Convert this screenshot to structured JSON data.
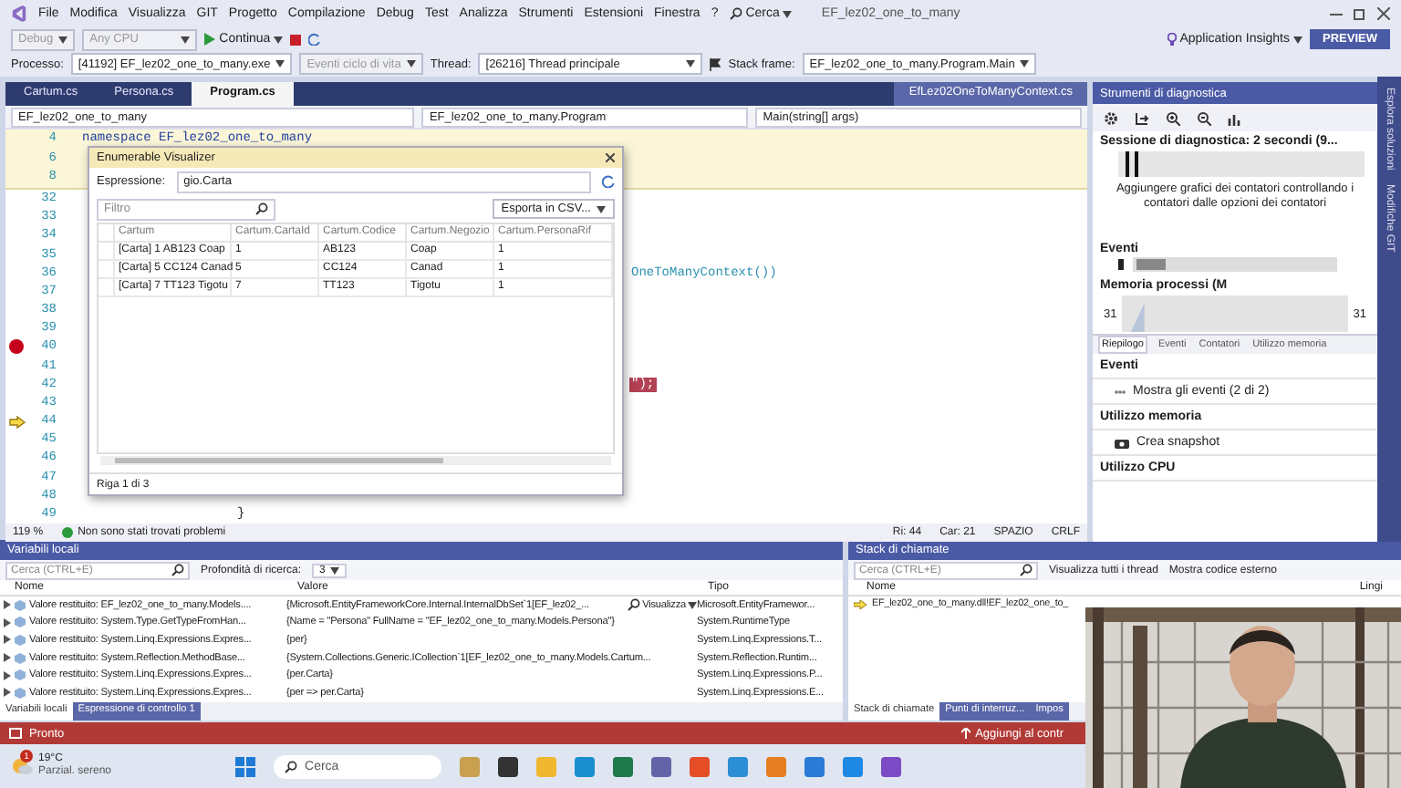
{
  "menu_bar": {
    "items": [
      "File",
      "Modifica",
      "Visualizza",
      "GIT",
      "Progetto",
      "Compilazione",
      "Debug",
      "Test",
      "Analizza",
      "Strumenti",
      "Estensioni",
      "Finestra",
      "?"
    ],
    "search": "Cerca",
    "title": "EF_lez02_one_to_many"
  },
  "toolbar": {
    "configuration": "Debug",
    "platform": "Any CPU",
    "continue": "Continua",
    "insights": "Application Insights",
    "preview": "PREVIEW"
  },
  "debug_location": {
    "process_label": "Processo:",
    "process": "[41192] EF_lez02_one_to_many.exe",
    "lifecycle": "Eventi ciclo di vita",
    "thread_label": "Thread:",
    "thread": "[26216] Thread principale",
    "frame_label": "Stack frame:",
    "frame": "EF_lez02_one_to_many.Program.Main"
  },
  "editor": {
    "tabs": [
      {
        "label": "Cartum.cs",
        "selected": false
      },
      {
        "label": "Persona.cs",
        "selected": false
      },
      {
        "label": "Program.cs",
        "selected": true
      }
    ],
    "preview_tab": "EfLez02OneToManyContext.cs",
    "nav": [
      "EF_lez02_one_to_many",
      "EF_lez02_one_to_many.Program",
      "Main(string[] args)"
    ],
    "sticky_lines": [
      {
        "number": "4",
        "code": "namespace EF_lez02_one_to_many"
      },
      {
        "number": "6"
      },
      {
        "number": "8"
      }
    ],
    "lines": [
      {
        "number": "32",
        "breakpoint": false,
        "current": false
      },
      {
        "number": "33",
        "breakpoint": false,
        "current": false
      },
      {
        "number": "34",
        "breakpoint": false,
        "current": false
      },
      {
        "number": "35",
        "breakpoint": false,
        "current": false
      },
      {
        "number": "36",
        "breakpoint": false,
        "current": false,
        "code": {
          "kind": "tail",
          "text": "OneToManyContext())",
          "highlighted": false
        }
      },
      {
        "number": "37",
        "breakpoint": false,
        "current": false
      },
      {
        "number": "38",
        "breakpoint": false,
        "current": false
      },
      {
        "number": "39",
        "breakpoint": false,
        "current": false
      },
      {
        "number": "40",
        "breakpoint": true,
        "current": false
      },
      {
        "number": "41",
        "breakpoint": false,
        "current": false
      },
      {
        "number": "42",
        "breakpoint": false,
        "current": false,
        "code": {
          "kind": "tail",
          "text": "\");",
          "highlighted": true
        }
      },
      {
        "number": "43",
        "breakpoint": false,
        "current": false
      },
      {
        "number": "44",
        "breakpoint": false,
        "current": true
      },
      {
        "number": "45",
        "breakpoint": false,
        "current": false
      },
      {
        "number": "46",
        "breakpoint": false,
        "current": false
      },
      {
        "number": "47",
        "breakpoint": false,
        "current": false
      },
      {
        "number": "48",
        "breakpoint": false,
        "current": false
      },
      {
        "number": "49",
        "breakpoint": false,
        "current": false,
        "code": {
          "kind": "full",
          "text": "}",
          "highlighted": false
        }
      }
    ],
    "status": {
      "zoom": "119 %",
      "problems": "Non sono stati trovati problemi",
      "position": [
        "Ri: 44",
        "Car: 21",
        "SPAZIO",
        "CRLF"
      ]
    }
  },
  "visualizer": {
    "title": "Enumerable Visualizer",
    "expression_label": "Espressione:",
    "expression": "gio.Carta",
    "filter_placeholder": "Filtro",
    "export": "Esporta in CSV...",
    "columns": [
      "Cartum",
      "Cartum.CartaId",
      "Cartum.Codice",
      "Cartum.Negozio",
      "Cartum.PersonaRif"
    ],
    "rows": [
      [
        "[Carta] 1 AB123 Coap",
        "1",
        "AB123",
        "Coap",
        "1"
      ],
      [
        "[Carta] 5 CC124 Canad",
        "5",
        "CC124",
        "Canad",
        "1"
      ],
      [
        "[Carta] 7 TT123 Tigotu",
        "7",
        "TT123",
        "Tigotu",
        "1"
      ]
    ],
    "footer": "Riga 1 di 3"
  },
  "diagnostics": {
    "title": "Strumenti di diagnostica",
    "session": "Sessione di diagnostica: 2 secondi (9...",
    "hint": "Aggiungere grafici dei contatori controllando i contatori dalle opzioni dei contatori",
    "events_label": "Eventi",
    "memory_label": "Memoria processi (M",
    "memory_min": "31",
    "memory_max": "31",
    "tabs": [
      {
        "label": "Riepilogo",
        "selected": true
      },
      {
        "label": "Eventi",
        "selected": false
      },
      {
        "label": "Contatori",
        "selected": false
      },
      {
        "label": "Utilizzo memoria",
        "selected": false
      }
    ],
    "sections": [
      {
        "kind": "header",
        "text": "Eventi"
      },
      {
        "kind": "events",
        "text": "Mostra gli eventi (2 di 2)"
      },
      {
        "kind": "header",
        "text": "Utilizzo memoria"
      },
      {
        "kind": "snapshot",
        "text": "Crea snapshot"
      },
      {
        "kind": "header",
        "text": "Utilizzo CPU"
      }
    ]
  },
  "side_tabs": [
    "Esplora soluzioni",
    "Modifiche GIT"
  ],
  "locals": {
    "title": "Variabili locali",
    "search_placeholder": "Cerca (CTRL+E)",
    "depth_label": "Profondità di ricerca:",
    "depth": "3",
    "columns": [
      "Nome",
      "Valore",
      "Tipo"
    ],
    "rows": [
      {
        "name": "Valore restituito: EF_lez02_one_to_many.Models....",
        "value": "{Microsoft.EntityFrameworkCore.Internal.InternalDbSet`1[EF_lez02_...",
        "action": "Visualizza",
        "type": "Microsoft.EntityFramewor..."
      },
      {
        "name": "Valore restituito: System.Type.GetTypeFromHan...",
        "value": "{Name = \"Persona\" FullName = \"EF_lez02_one_to_many.Models.Persona\"}",
        "type": "System.RuntimeType"
      },
      {
        "name": "Valore restituito: System.Linq.Expressions.Expres...",
        "value": "{per}",
        "type": "System.Linq.Expressions.T..."
      },
      {
        "name": "Valore restituito: System.Reflection.MethodBase...",
        "value": "{System.Collections.Generic.ICollection`1[EF_lez02_one_to_many.Models.Cartum...",
        "type": "System.Reflection.Runtim..."
      },
      {
        "name": "Valore restituito: System.Linq.Expressions.Expres...",
        "value": "{per.Carta}",
        "type": "System.Linq.Expressions.P..."
      },
      {
        "name": "Valore restituito: System.Linq.Expressions.Expres...",
        "value": "{per => per.Carta}",
        "type": "System.Linq.Expressions.E..."
      }
    ],
    "tabs": [
      {
        "label": "Variabili locali",
        "selected": true
      },
      {
        "label": "Espressione di controllo 1",
        "selected": false
      }
    ]
  },
  "callstack": {
    "title": "Stack di chiamate",
    "search_placeholder": "Cerca (CTRL+E)",
    "show_threads": "Visualizza tutti i thread",
    "external": "Mostra codice esterno",
    "columns": [
      "Nome",
      "Lingi"
    ],
    "rows": [
      "EF_lez02_one_to_many.dll!EF_lez02_one_to_"
    ],
    "tabs": [
      {
        "label": "Stack di chiamate",
        "selected": true
      },
      {
        "label": "Punti di interruz...",
        "selected": false
      },
      {
        "label": "Impos",
        "selected": false
      }
    ]
  },
  "status_bar": {
    "text": "Pronto",
    "action": "Aggiungi al contr"
  },
  "taskbar": {
    "temperature": "19°C",
    "weather": "Parzial. sereno",
    "badge": "1",
    "search": "Cerca"
  },
  "webcam": {
    "kind": "picture"
  }
}
